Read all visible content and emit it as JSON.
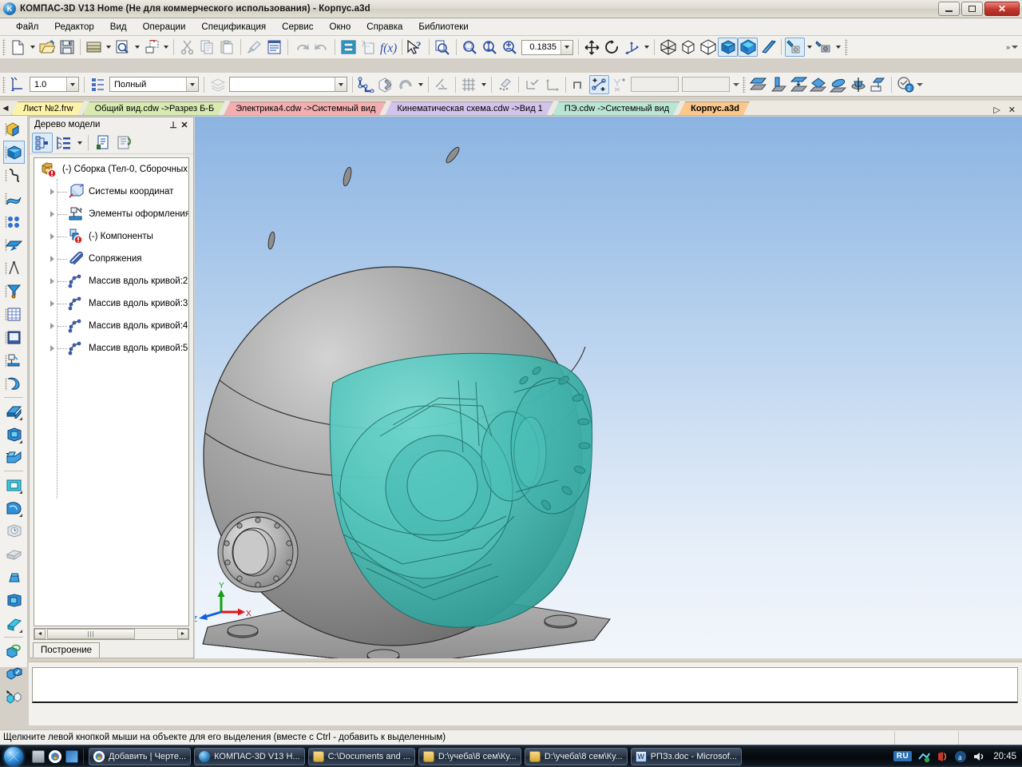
{
  "window": {
    "title": "КОМПАС-3D V13 Home (Не для коммерческого использования) - Корпус.a3d",
    "app_icon": "kompas-logo-icon",
    "minimize_label": "Свернуть",
    "maximize_label": "Развернуть",
    "close_label": "Закрыть"
  },
  "menu": {
    "items": [
      {
        "label": "Файл"
      },
      {
        "label": "Редактор"
      },
      {
        "label": "Вид"
      },
      {
        "label": "Операции"
      },
      {
        "label": "Спецификация"
      },
      {
        "label": "Сервис"
      },
      {
        "label": "Окно"
      },
      {
        "label": "Справка"
      },
      {
        "label": "Библиотеки"
      }
    ]
  },
  "toolbar_standard": {
    "buttons": [
      {
        "name": "new-document-button",
        "icon": "new-document-icon"
      },
      {
        "name": "open-document-button",
        "icon": "open-folder-icon"
      },
      {
        "name": "save-document-button",
        "icon": "floppy-disk-icon"
      },
      {
        "name": "print-button",
        "icon": "printer-icon"
      },
      {
        "name": "print-preview-button",
        "icon": "print-preview-icon"
      },
      {
        "name": "send-document-button",
        "icon": "send-document-icon"
      },
      {
        "name": "cut-button",
        "icon": "scissors-icon"
      },
      {
        "name": "copy-button",
        "icon": "copy-icon"
      },
      {
        "name": "paste-button",
        "icon": "paste-icon"
      },
      {
        "name": "format-painter-button",
        "icon": "paintbrush-icon"
      },
      {
        "name": "properties-button",
        "icon": "properties-list-icon"
      },
      {
        "name": "undo-button",
        "icon": "undo-arrow-icon"
      },
      {
        "name": "redo-button",
        "icon": "redo-arrow-icon"
      },
      {
        "name": "manager-button",
        "icon": "document-manager-icon"
      },
      {
        "name": "variables-button",
        "icon": "variables-icon"
      },
      {
        "name": "expression-button",
        "icon": "f-of-x-icon"
      },
      {
        "name": "context-help-button",
        "icon": "pointer-question-icon"
      }
    ]
  },
  "toolbar_view": {
    "zoom_value": "0.1835",
    "buttons": [
      {
        "name": "zoom-to-fit-button",
        "icon": "zoom-fit-icon"
      },
      {
        "name": "zoom-window-button",
        "icon": "zoom-window-icon"
      },
      {
        "name": "zoom-scale-button",
        "icon": "zoom-scale-icon"
      },
      {
        "name": "zoom-in-out-button",
        "icon": "zoom-plusminus-icon"
      },
      {
        "name": "pan-button",
        "icon": "pan-move-icon"
      },
      {
        "name": "rotate-button",
        "icon": "rotate-icon"
      },
      {
        "name": "orientation-button",
        "icon": "axis-orientation-icon"
      },
      {
        "name": "wireframe-button",
        "icon": "wireframe-sphere-icon"
      },
      {
        "name": "hidden-lines-thin-button",
        "icon": "hidden-lines-cube-icon"
      },
      {
        "name": "hidden-lines-button",
        "icon": "hidden-line-sphere-icon"
      },
      {
        "name": "shaded-with-edges-button",
        "icon": "shaded-edges-icon"
      },
      {
        "name": "shaded-button",
        "icon": "shaded-cube-icon"
      },
      {
        "name": "perspective-button",
        "icon": "perspective-icon"
      },
      {
        "name": "lighting-button",
        "icon": "lighting-icon"
      },
      {
        "name": "camera-button",
        "icon": "camera-icon"
      }
    ]
  },
  "toolbar_current_state": {
    "step_value": "1.0",
    "detail_level": "Полный",
    "style_value": "",
    "buttons": [
      {
        "name": "restrictions-button",
        "icon": "restrictions-icon"
      },
      {
        "name": "layers-button",
        "icon": "layers-icon"
      },
      {
        "name": "sketch-button",
        "icon": "sketch-profile-icon"
      },
      {
        "name": "edit-sketch-button",
        "icon": "edit-sketch-icon"
      },
      {
        "name": "snap-button",
        "icon": "magnet-snap-icon"
      },
      {
        "name": "parallel-button",
        "icon": "parallel-lines-icon"
      },
      {
        "name": "grid-button",
        "icon": "grid-icon"
      },
      {
        "name": "snap-points-button",
        "icon": "snap-points-icon"
      },
      {
        "name": "apply-button",
        "icon": "apply-check-icon"
      },
      {
        "name": "local-cs-button",
        "icon": "local-coordinate-icon"
      },
      {
        "name": "step-button",
        "icon": "step-icon"
      },
      {
        "name": "points-line-button",
        "icon": "points-line-icon"
      },
      {
        "name": "ortho-button",
        "icon": "ortho-icon"
      }
    ]
  },
  "toolbar_geometry": {
    "buttons": [
      {
        "name": "offset-plane-button",
        "icon": "offset-plane-icon"
      },
      {
        "name": "plane-at-angle-button",
        "icon": "plane-angle-icon"
      },
      {
        "name": "plane-through-three-points-button",
        "icon": "plane-three-points-icon"
      },
      {
        "name": "plane-normal-button",
        "icon": "plane-normal-icon"
      },
      {
        "name": "axis-through-edge-button",
        "icon": "axis-edge-icon"
      },
      {
        "name": "axis-of-revolution-button",
        "icon": "axis-revolution-icon"
      },
      {
        "name": "axis-two-planes-button",
        "icon": "axis-two-planes-icon"
      },
      {
        "name": "local-coordinate-system-button",
        "icon": "local-cs-icon"
      }
    ]
  },
  "document_tabs": {
    "prev_label": "◀",
    "next_label": "▷",
    "close_label": "✕",
    "items": [
      {
        "label": "Лист №2.frw",
        "color": "#fdf3a8",
        "selected": false
      },
      {
        "label": "Общий вид.cdw ->Разрез Б-Б",
        "color": "#d7eab1",
        "selected": false
      },
      {
        "label": "Электрика4.cdw ->Системный вид",
        "color": "#f3aeb0",
        "selected": false
      },
      {
        "label": "Кинематическая схема.cdw ->Вид 1",
        "color": "#d2c3ec",
        "selected": false
      },
      {
        "label": "ПЭ.cdw ->Системный вид",
        "color": "#b9e5d4",
        "selected": false
      },
      {
        "label": "Корпус.a3d",
        "color": "#fcc78a",
        "selected": true
      }
    ]
  },
  "left_toolbar": {
    "buttons": [
      {
        "name": "edit-part-button",
        "icon": "edit-part-icon",
        "active": false
      },
      {
        "name": "create-body-button",
        "icon": "solid-body-icon",
        "active": true
      },
      {
        "name": "spatial-curves-button",
        "icon": "spline-curve-icon",
        "active": false
      },
      {
        "name": "surfaces-button",
        "icon": "surface-icon",
        "active": false
      },
      {
        "name": "points-button",
        "icon": "points-array-icon",
        "active": false
      },
      {
        "name": "auxiliary-geometry-button",
        "icon": "auxiliary-plane-icon",
        "active": false
      },
      {
        "name": "measurements-button",
        "icon": "compass-measure-icon",
        "active": false
      },
      {
        "name": "filters-button",
        "icon": "funnel-filter-icon",
        "active": false
      },
      {
        "name": "specification-button",
        "icon": "spec-table-icon",
        "active": false
      },
      {
        "name": "report-button",
        "icon": "report-icon",
        "active": false
      },
      {
        "name": "design-elements-button",
        "icon": "design-elements-icon",
        "active": false
      },
      {
        "name": "shell-button",
        "icon": "shell-icon",
        "active": false
      },
      {
        "name": "extrude-button",
        "icon": "extrude-icon",
        "active": false
      },
      {
        "name": "revolve-button",
        "icon": "revolve-icon",
        "active": false
      },
      {
        "name": "loft-button",
        "icon": "loft-icon",
        "active": false
      },
      {
        "name": "cut-extrude-button",
        "icon": "cut-extrude-icon",
        "active": false
      },
      {
        "name": "cut-revolve-button",
        "icon": "cut-revolve-icon",
        "active": false
      },
      {
        "name": "hole-button",
        "icon": "hole-icon",
        "active": false
      },
      {
        "name": "rib-button",
        "icon": "rib-icon",
        "active": false
      },
      {
        "name": "draft-button",
        "icon": "draft-angle-icon",
        "active": false
      },
      {
        "name": "thin-wall-button",
        "icon": "thin-wall-icon",
        "active": false
      },
      {
        "name": "fillet-button",
        "icon": "fillet-icon",
        "active": false
      },
      {
        "name": "chamfer-button",
        "icon": "chamfer-icon",
        "active": false
      },
      {
        "name": "mirror-button",
        "icon": "mirror-copy-icon",
        "active": false
      },
      {
        "name": "pattern-button",
        "icon": "pattern-array-icon",
        "active": false
      }
    ]
  },
  "model_tree": {
    "title": "Дерево модели",
    "pin_label": "⊥",
    "close_label": "✕",
    "toolbar": [
      {
        "name": "tree-structure-button",
        "icon": "tree-structure-icon",
        "active": true
      },
      {
        "name": "tree-display-order-button",
        "icon": "tree-order-icon",
        "active": false
      },
      {
        "name": "tree-properties-button",
        "icon": "tree-properties-icon",
        "active": false
      },
      {
        "name": "tree-relations-button",
        "icon": "tree-relations-icon",
        "active": false
      }
    ],
    "nodes": [
      {
        "label": "(-) Сборка (Тел-0, Сборочных",
        "icon": "assembly-warning-icon",
        "level": 0,
        "expandable": false
      },
      {
        "label": "Системы координат",
        "icon": "coordinate-system-icon",
        "level": 1,
        "expandable": true
      },
      {
        "label": "Элементы оформления",
        "icon": "design-elements-icon",
        "level": 1,
        "expandable": true
      },
      {
        "label": "(-) Компоненты",
        "icon": "components-warning-icon",
        "level": 1,
        "expandable": true
      },
      {
        "label": "Сопряжения",
        "icon": "mates-paperclip-icon",
        "level": 1,
        "expandable": true
      },
      {
        "label": "Массив вдоль кривой:2",
        "icon": "pattern-along-curve-icon",
        "level": 1,
        "expandable": true
      },
      {
        "label": "Массив вдоль кривой:3",
        "icon": "pattern-along-curve-icon",
        "level": 1,
        "expandable": true
      },
      {
        "label": "Массив вдоль кривой:4",
        "icon": "pattern-along-curve-icon",
        "level": 1,
        "expandable": true
      },
      {
        "label": "Массив вдоль кривой:5",
        "icon": "pattern-along-curve-icon",
        "level": 1,
        "expandable": true
      }
    ],
    "scroll_left_label": "◄",
    "scroll_right_label": "►",
    "bottom_tab": "Построение"
  },
  "viewport": {
    "axes": {
      "x_label": "X",
      "y_label": "Y",
      "z_label": "Z",
      "x_color": "#e01818",
      "y_color": "#12a012",
      "z_color": "#1060e0"
    },
    "model": {
      "body_color": "#9e9e9e",
      "transparent_color": "#45bcb4",
      "description": "Сферический корпус редуктора на фланцевом основании"
    },
    "background_top": "#8cb4e2",
    "background_bottom": "#f2f6fb"
  },
  "status": {
    "message": "Щелкните левой кнопкой мыши на объекте для его выделения (вместе с Ctrl - добавить к выделенным)"
  },
  "taskbar": {
    "start_label": "Пуск",
    "quick_launch": [
      {
        "name": "show-desktop-icon"
      },
      {
        "name": "chrome-icon"
      },
      {
        "name": "media-player-icon"
      }
    ],
    "buttons": [
      {
        "label": "Добавить | Черте...",
        "icon": "chrome-icon"
      },
      {
        "label": "КОМПАС-3D V13 H...",
        "icon": "kompas-icon"
      },
      {
        "label": "C:\\Documents and ...",
        "icon": "folder-icon"
      },
      {
        "label": "D:\\учеба\\8 сем\\Ку...",
        "icon": "folder-icon"
      },
      {
        "label": "D:\\учеба\\8 сем\\Ку...",
        "icon": "folder-icon"
      },
      {
        "label": "РПЗз.doc - Microsof...",
        "icon": "word-icon"
      }
    ],
    "language": "RU",
    "tray": [
      {
        "name": "network-icon"
      },
      {
        "name": "antivirus-icon"
      },
      {
        "name": "adobe-icon"
      },
      {
        "name": "volume-icon"
      }
    ],
    "clock": "20:45"
  }
}
